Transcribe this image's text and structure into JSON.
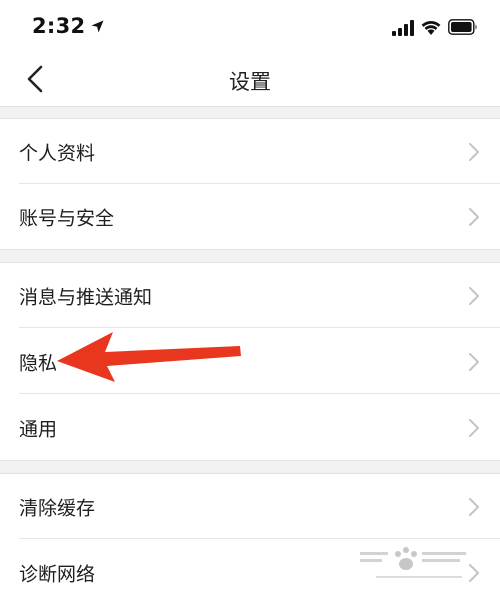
{
  "status_bar": {
    "time": "2:32",
    "icons": [
      "location-icon",
      "signal-icon",
      "wifi-icon",
      "battery-icon"
    ]
  },
  "nav": {
    "title": "设置",
    "back_icon": "chevron-left-icon"
  },
  "groups": [
    {
      "items": [
        {
          "label": "个人资料",
          "icon": "chevron-right-icon"
        },
        {
          "label": "账号与安全",
          "icon": "chevron-right-icon"
        }
      ]
    },
    {
      "items": [
        {
          "label": "消息与推送通知",
          "icon": "chevron-right-icon"
        },
        {
          "label": "隐私",
          "icon": "chevron-right-icon"
        },
        {
          "label": "通用",
          "icon": "chevron-right-icon"
        }
      ]
    },
    {
      "items": [
        {
          "label": "清除缓存",
          "icon": "chevron-right-icon"
        },
        {
          "label": "诊断网络",
          "icon": "chevron-right-icon"
        }
      ]
    }
  ],
  "colors": {
    "background": "#ffffff",
    "separator": "#f2f2f2",
    "divider": "#e6e6e6",
    "chevron": "#c4c4c4",
    "annotation_arrow": "#e8361f"
  }
}
